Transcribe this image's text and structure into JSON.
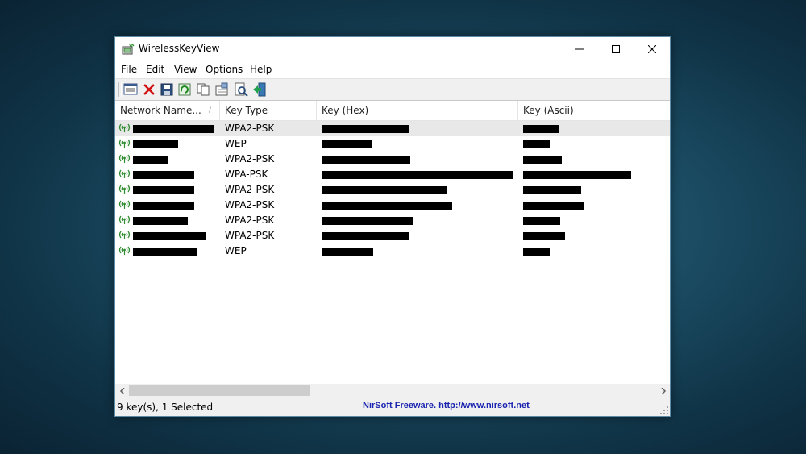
{
  "window": {
    "title": "WirelessKeyView",
    "controls": {
      "minimize": "minimize",
      "maximize": "maximize",
      "close": "close"
    }
  },
  "menu": [
    "File",
    "Edit",
    "View",
    "Options",
    "Help"
  ],
  "toolbar": {
    "icons": [
      "html-report-icon",
      "delete-icon",
      "save-icon",
      "refresh-icon",
      "copy-icon",
      "properties-icon",
      "find-icon",
      "exit-icon"
    ]
  },
  "table": {
    "columns": [
      "Network Name...",
      "Key Type",
      "Key (Hex)",
      "Key (Ascii)"
    ],
    "sorted_column": "Network Name...",
    "rows": [
      {
        "key_type": "WPA2-PSK",
        "selected": true
      },
      {
        "key_type": "WEP",
        "selected": false
      },
      {
        "key_type": "WPA2-PSK",
        "selected": false
      },
      {
        "key_type": "WPA-PSK",
        "selected": false
      },
      {
        "key_type": "WPA2-PSK",
        "selected": false
      },
      {
        "key_type": "WPA2-PSK",
        "selected": false
      },
      {
        "key_type": "WPA2-PSK",
        "selected": false
      },
      {
        "key_type": "WPA2-PSK",
        "selected": false
      },
      {
        "key_type": "WEP",
        "selected": false
      }
    ]
  },
  "status": {
    "count": "9 key(s), 1 Selected",
    "credit": "NirSoft Freeware.  http://www.nirsoft.net"
  },
  "colors": {
    "status_link": "#1a24b0",
    "selected_row": "#e8e8e8",
    "wifi_icon": "#2e8b2e"
  }
}
